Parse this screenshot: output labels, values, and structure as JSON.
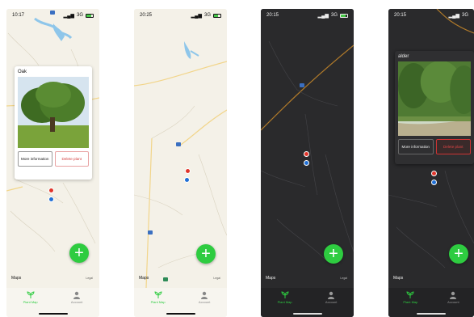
{
  "screens": [
    {
      "theme": "light",
      "time": "10:17",
      "network": "3G",
      "battery_level": 0.8,
      "popup": {
        "plant_name": "Oak",
        "more_info_label": "More information",
        "delete_label": "Delete plant"
      },
      "maps_label": "Maps",
      "legal_label": "Legal",
      "tabs": [
        {
          "label": "Plant Map",
          "icon": "plant-icon"
        },
        {
          "label": "Account",
          "icon": "person-icon"
        }
      ],
      "fab_label": "+"
    },
    {
      "theme": "light",
      "time": "20:25",
      "network": "3G",
      "battery_level": 0.6,
      "maps_label": "Maps",
      "legal_label": "Legal",
      "tabs": [
        {
          "label": "Plant Map",
          "icon": "plant-icon"
        },
        {
          "label": "Account",
          "icon": "person-icon"
        }
      ],
      "fab_label": "+"
    },
    {
      "theme": "dark",
      "time": "20:15",
      "network": "3G",
      "battery_level": 0.7,
      "maps_label": "Maps",
      "legal_label": "Legal",
      "tabs": [
        {
          "label": "Plant Map",
          "icon": "plant-icon"
        },
        {
          "label": "Account",
          "icon": "person-icon"
        }
      ],
      "fab_label": "+"
    },
    {
      "theme": "dark",
      "time": "20:15",
      "network": "3G",
      "battery_level": 0.7,
      "popup": {
        "plant_name": "alder",
        "more_info_label": "More information",
        "delete_label": "Delete plant"
      },
      "maps_label": "Maps",
      "legal_label": "Legal",
      "tabs": [
        {
          "label": "Plant Map",
          "icon": "plant-icon"
        },
        {
          "label": "Account",
          "icon": "person-icon"
        }
      ],
      "fab_label": "+"
    }
  ],
  "colors": {
    "fab_green": "#2ecc40",
    "pin_red": "#e0342a",
    "location_blue": "#1f6fd6",
    "delete_red": "#d23b3b",
    "tab_active_green": "#2ecc40"
  }
}
